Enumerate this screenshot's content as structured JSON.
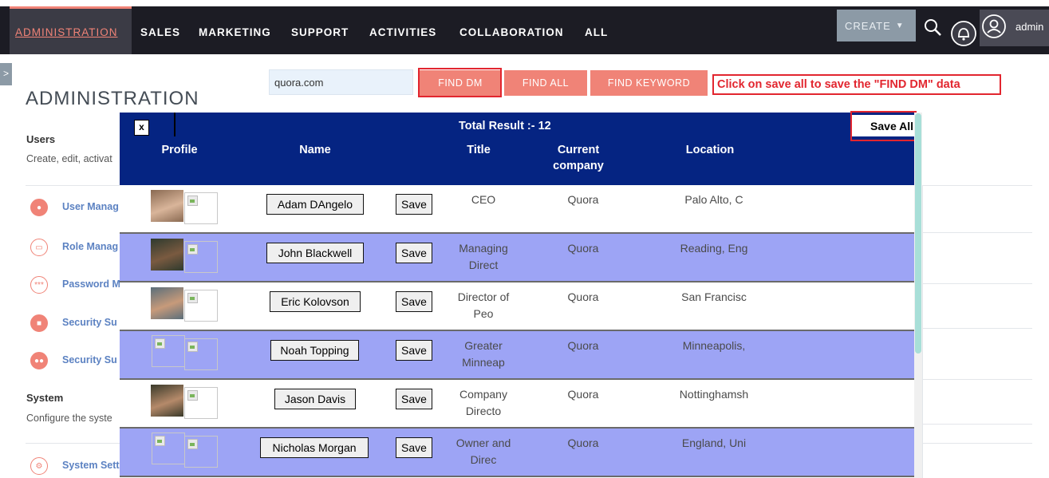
{
  "nav": {
    "items": [
      "ADMINISTRATION",
      "SALES",
      "MARKETING",
      "SUPPORT",
      "ACTIVITIES",
      "COLLABORATION",
      "ALL"
    ],
    "create_label": "CREATE",
    "user_label": "admin",
    "side_toggle": ">"
  },
  "page": {
    "title": "ADMINISTRATION",
    "search_value": "quora.com",
    "find_dm": "FIND DM",
    "find_all": "FIND ALL",
    "find_keyword": "FIND KEYWORD",
    "callout": "Click on save all to save the \"FIND DM\" data"
  },
  "sections": [
    {
      "title": "Users",
      "desc": "Create, edit, activat",
      "items": [
        {
          "label": "User Manag",
          "icon": "user-icon"
        },
        {
          "label": "Role Manag",
          "icon": "role-icon"
        },
        {
          "label": "Password M",
          "icon": "password-icon"
        },
        {
          "label": "Security Su",
          "icon": "lock-icon"
        },
        {
          "label": "Security Su",
          "icon": "group-icon"
        }
      ]
    },
    {
      "title": "System",
      "desc": "Configure the syste",
      "items": [
        {
          "label": "System Sett",
          "icon": "gear-icon"
        }
      ]
    }
  ],
  "modal": {
    "close_label": "x",
    "total": "Total Result :- 12",
    "save_all": "Save All",
    "headers": [
      "Profile",
      "Name",
      "Title",
      "Current company",
      "Location"
    ],
    "rows": [
      {
        "name": "Adam DAngelo",
        "title": "CEO",
        "company": "Quora",
        "location": "Palo Alto, C",
        "photo": true
      },
      {
        "name": "John Blackwell",
        "title": "Managing Direct",
        "company": "Quora",
        "location": "Reading, Eng",
        "photo": true
      },
      {
        "name": "Eric Kolovson",
        "title": "Director of Peo",
        "company": "Quora",
        "location": "San Francisc",
        "photo": true
      },
      {
        "name": "Noah Topping",
        "title": "Greater Minneap",
        "company": "Quora",
        "location": "Minneapolis,",
        "photo": false
      },
      {
        "name": "Jason Davis",
        "title": "Company Directo",
        "company": "Quora",
        "location": "Nottinghamsh",
        "photo": true
      },
      {
        "name": "Nicholas Morgan",
        "title": "Owner and Direc",
        "company": "Quora",
        "location": "England, Uni",
        "photo": false
      }
    ],
    "save_label": "Save"
  },
  "colors": {
    "accent": "#f08377",
    "header_blue": "#052482",
    "row_alt": "#9da4f5",
    "highlight_red": "#e2262f",
    "nav_bg": "#1c1c24"
  }
}
